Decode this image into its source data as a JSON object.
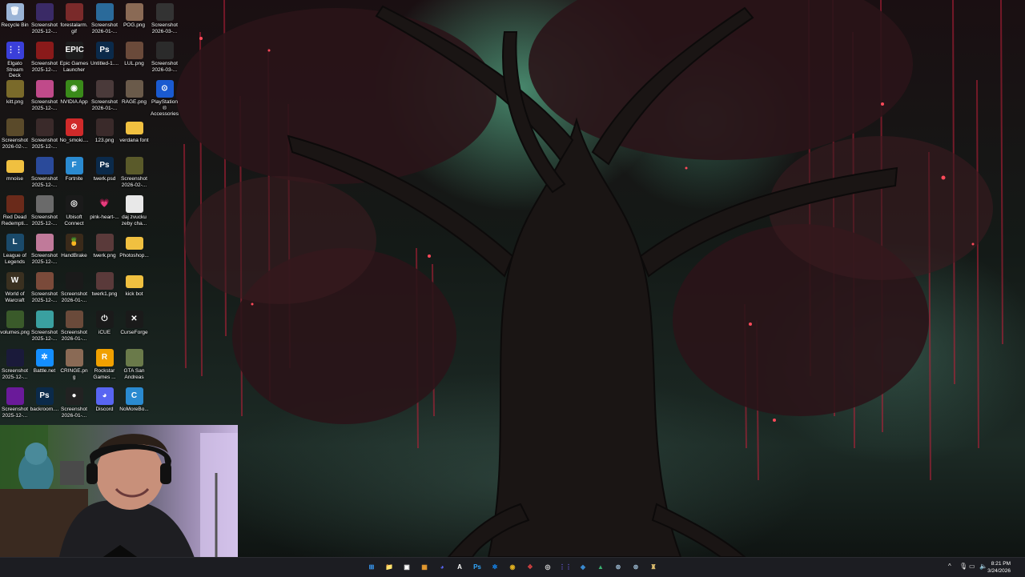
{
  "desktop": {
    "icons": [
      {
        "label": "Recycle Bin",
        "icon": "recycle-bin-icon",
        "color": "#9bb4d6",
        "glyph": "🗑"
      },
      {
        "label": "Screenshot 2025-12-...",
        "icon": "image-file-icon",
        "color": "#3a2a66",
        "glyph": ""
      },
      {
        "label": "forestalarm.gif",
        "icon": "image-file-icon",
        "color": "#7a2a2a",
        "glyph": ""
      },
      {
        "label": "Screenshot 2026-01-...",
        "icon": "image-file-icon",
        "color": "#2a6a9a",
        "glyph": ""
      },
      {
        "label": "POG.png",
        "icon": "image-file-icon",
        "color": "#8a6a55",
        "glyph": ""
      },
      {
        "label": "Screenshot 2026-03-...",
        "icon": "image-file-icon",
        "color": "#333",
        "glyph": ""
      },
      {
        "label": "Elgato Stream Deck",
        "icon": "stream-deck-icon",
        "color": "#3a3fd9",
        "glyph": "⋮⋮"
      },
      {
        "label": "Screenshot 2025-12-...",
        "icon": "image-file-icon",
        "color": "#8a1a1a",
        "glyph": ""
      },
      {
        "label": "Epic Games Launcher",
        "icon": "epic-games-icon",
        "color": "#1d1d1d",
        "glyph": "EPIC"
      },
      {
        "label": "Untitled-1....",
        "icon": "photoshop-file-icon",
        "color": "#0b2a4a",
        "glyph": "Ps"
      },
      {
        "label": "LUL.png",
        "icon": "image-file-icon",
        "color": "#6a4a3a",
        "glyph": ""
      },
      {
        "label": "Screenshot 2026-03-...",
        "icon": "image-file-icon",
        "color": "#2b2b2b",
        "glyph": ""
      },
      {
        "label": "kitt.png",
        "icon": "image-file-icon",
        "color": "#7a6a2a",
        "glyph": ""
      },
      {
        "label": "Screenshot 2025-12-...",
        "icon": "image-file-icon",
        "color": "#c04a8a",
        "glyph": ""
      },
      {
        "label": "NVIDIA App",
        "icon": "nvidia-icon",
        "color": "#3a8a1a",
        "glyph": "◉"
      },
      {
        "label": "Screenshot 2026-01-...",
        "icon": "image-file-icon",
        "color": "#4a3a3a",
        "glyph": ""
      },
      {
        "label": "RAGE.png",
        "icon": "image-file-icon",
        "color": "#6a5a4a",
        "glyph": ""
      },
      {
        "label": "PlayStation® Accessories",
        "icon": "playstation-icon",
        "color": "#1a5ad0",
        "glyph": "⊙"
      },
      {
        "label": "Screenshot 2026-02-...",
        "icon": "image-file-icon",
        "color": "#5a4a2a",
        "glyph": ""
      },
      {
        "label": "Screenshot 2025-12-...",
        "icon": "image-file-icon",
        "color": "#3a2a2a",
        "glyph": ""
      },
      {
        "label": "No_smoki....",
        "icon": "image-file-icon",
        "color": "#d02a2a",
        "glyph": "⊘"
      },
      {
        "label": "123.png",
        "icon": "image-file-icon",
        "color": "#3a2a2a",
        "glyph": ""
      },
      {
        "label": "verdana font",
        "icon": "folder-icon",
        "color": "#f0c040",
        "glyph": ""
      },
      {
        "label": "",
        "icon": "",
        "color": "",
        "glyph": ""
      },
      {
        "label": "mnoise",
        "icon": "folder-icon",
        "color": "#f0c040",
        "glyph": ""
      },
      {
        "label": "Screenshot 2025-12-...",
        "icon": "image-file-icon",
        "color": "#2a4a9a",
        "glyph": ""
      },
      {
        "label": "Fortnite",
        "icon": "fortnite-icon",
        "color": "#2a8ad0",
        "glyph": "F"
      },
      {
        "label": "twerk.psd",
        "icon": "photoshop-file-icon",
        "color": "#0b2a4a",
        "glyph": "Ps"
      },
      {
        "label": "Screenshot 2026-02-...",
        "icon": "image-file-icon",
        "color": "#5a5a2a",
        "glyph": ""
      },
      {
        "label": "",
        "icon": "",
        "color": "",
        "glyph": ""
      },
      {
        "label": "Red Dead Redempti...",
        "icon": "game-shortcut-icon",
        "color": "#6a2a1a",
        "glyph": ""
      },
      {
        "label": "Screenshot 2025-12-...",
        "icon": "image-file-icon",
        "color": "#6a6a6a",
        "glyph": ""
      },
      {
        "label": "Ubisoft Connect",
        "icon": "ubisoft-icon",
        "color": "#1a1a1a",
        "glyph": "◎"
      },
      {
        "label": "pink-heart-...",
        "icon": "image-file-icon",
        "color": "transparent",
        "glyph": "💗"
      },
      {
        "label": "daj zvucku zeby cha...",
        "icon": "text-file-icon",
        "color": "#e8e8e8",
        "glyph": ""
      },
      {
        "label": "",
        "icon": "",
        "color": "",
        "glyph": ""
      },
      {
        "label": "League of Legends",
        "icon": "league-icon",
        "color": "#1a4a6a",
        "glyph": "L"
      },
      {
        "label": "Screenshot 2025-12-...",
        "icon": "image-file-icon",
        "color": "#c07a9a",
        "glyph": ""
      },
      {
        "label": "HandBrake",
        "icon": "handbrake-icon",
        "color": "#3a2a1a",
        "glyph": "🍍"
      },
      {
        "label": "twerk.png",
        "icon": "image-file-icon",
        "color": "#5a3a3a",
        "glyph": ""
      },
      {
        "label": "Photoshop...",
        "icon": "folder-icon",
        "color": "#f0c040",
        "glyph": ""
      },
      {
        "label": "",
        "icon": "",
        "color": "",
        "glyph": ""
      },
      {
        "label": "World of Warcraft",
        "icon": "wow-icon",
        "color": "#3a3020",
        "glyph": "W"
      },
      {
        "label": "Screenshot 2025-12-...",
        "icon": "image-file-icon",
        "color": "#7a4a3a",
        "glyph": ""
      },
      {
        "label": "Screenshot 2026-01-...",
        "icon": "image-file-icon",
        "color": "#1a1a1a",
        "glyph": ""
      },
      {
        "label": "twerk1.png",
        "icon": "image-file-icon",
        "color": "#5a3a3a",
        "glyph": ""
      },
      {
        "label": "kick bot",
        "icon": "folder-icon",
        "color": "#f0c040",
        "glyph": ""
      },
      {
        "label": "",
        "icon": "",
        "color": "",
        "glyph": ""
      },
      {
        "label": "volumes.png",
        "icon": "image-file-icon",
        "color": "#3a5a2a",
        "glyph": ""
      },
      {
        "label": "Screenshot 2025-12-...",
        "icon": "image-file-icon",
        "color": "#3aa0a0",
        "glyph": ""
      },
      {
        "label": "Screenshot 2026-01-...",
        "icon": "image-file-icon",
        "color": "#6a4a3a",
        "glyph": ""
      },
      {
        "label": "iCUE",
        "icon": "icue-icon",
        "color": "#1a1a1a",
        "glyph": "⏻"
      },
      {
        "label": "CurseForge",
        "icon": "curseforge-icon",
        "color": "#1a1a1a",
        "glyph": "✕"
      },
      {
        "label": "",
        "icon": "",
        "color": "",
        "glyph": ""
      },
      {
        "label": "Screenshot 2025-12-...",
        "icon": "image-file-icon",
        "color": "#1a1a3a",
        "glyph": ""
      },
      {
        "label": "Battle.net",
        "icon": "battlenet-icon",
        "color": "#148eff",
        "glyph": "✲"
      },
      {
        "label": "CRINGE.png",
        "icon": "image-file-icon",
        "color": "#8a6a55",
        "glyph": ""
      },
      {
        "label": "Rockstar Games ...",
        "icon": "rockstar-icon",
        "color": "#f0a000",
        "glyph": "R"
      },
      {
        "label": "GTA San Andreas",
        "icon": "gta-icon",
        "color": "#6a7a4a",
        "glyph": ""
      },
      {
        "label": "",
        "icon": "",
        "color": "",
        "glyph": ""
      },
      {
        "label": "Screenshot 2025-12-...",
        "icon": "image-file-icon",
        "color": "#6a1a9a",
        "glyph": ""
      },
      {
        "label": "backroom....",
        "icon": "photoshop-file-icon",
        "color": "#0b2a4a",
        "glyph": "Ps"
      },
      {
        "label": "Screenshot 2026-01-...",
        "icon": "image-file-icon",
        "color": "#222",
        "glyph": "●"
      },
      {
        "label": "Discord",
        "icon": "discord-icon",
        "color": "#5865f2",
        "glyph": "◕"
      },
      {
        "label": "NoMoreBo...",
        "icon": "app-icon",
        "color": "#2a8ad0",
        "glyph": "C"
      },
      {
        "label": "",
        "icon": "",
        "color": "",
        "glyph": ""
      }
    ]
  },
  "taskbar": {
    "apps": [
      {
        "name": "start-button",
        "glyph": "⊞",
        "color": "#3aa0ff"
      },
      {
        "name": "file-explorer",
        "glyph": "📁",
        "color": "#f0c040"
      },
      {
        "name": "app-button",
        "glyph": "▣",
        "color": "#ffffff"
      },
      {
        "name": "app-button",
        "glyph": "▦",
        "color": "#f0a030"
      },
      {
        "name": "discord",
        "glyph": "◕",
        "color": "#5865f2"
      },
      {
        "name": "app-button",
        "glyph": "A",
        "color": "#ffffff"
      },
      {
        "name": "photoshop",
        "glyph": "Ps",
        "color": "#31a8ff"
      },
      {
        "name": "battlenet",
        "glyph": "✲",
        "color": "#148eff"
      },
      {
        "name": "chrome",
        "glyph": "◉",
        "color": "#e0b020"
      },
      {
        "name": "app-button",
        "glyph": "❖",
        "color": "#d04040"
      },
      {
        "name": "obs",
        "glyph": "◎",
        "color": "#dddddd"
      },
      {
        "name": "stream-deck",
        "glyph": "⋮⋮",
        "color": "#6a5ae0"
      },
      {
        "name": "app-button",
        "glyph": "◆",
        "color": "#3a8ad0"
      },
      {
        "name": "app-button",
        "glyph": "▲",
        "color": "#3ab070"
      },
      {
        "name": "steam",
        "glyph": "⊛",
        "color": "#9ab8d0"
      },
      {
        "name": "steam-secondary",
        "glyph": "⊛",
        "color": "#9ab8d0"
      },
      {
        "name": "app-button",
        "glyph": "♜",
        "color": "#e0c070"
      }
    ],
    "clock": {
      "time": "8:21 PM",
      "date": "3/24/2026"
    }
  }
}
